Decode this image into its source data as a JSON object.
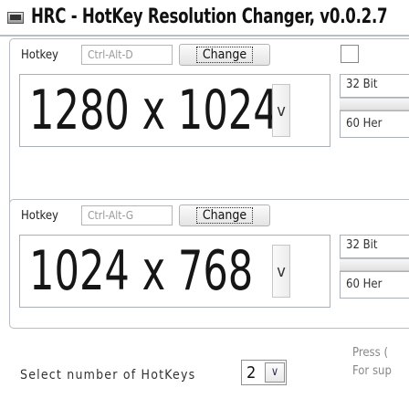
{
  "window": {
    "title": "HRC - HotKey Resolution Changer, v0.0.2.7",
    "icon": "monitor-icon"
  },
  "profiles": [
    {
      "hotkey_label": "Hotkey",
      "hotkey_value": "Ctrl-Alt-D",
      "change_label": "Change",
      "resolution": "1280 x 1024",
      "bit_depth": "32 Bit",
      "refresh_rate": "60 Her"
    },
    {
      "hotkey_label": "Hotkey",
      "hotkey_value": "Ctrl-Alt-G",
      "change_label": "Change",
      "resolution": "1024 x 768",
      "bit_depth": "32 Bit",
      "refresh_rate": "60 Her"
    }
  ],
  "footer": {
    "select_label": "Select number of HotKeys",
    "select_value": "2",
    "note_line1": "Press (",
    "note_line2": "For sup"
  }
}
